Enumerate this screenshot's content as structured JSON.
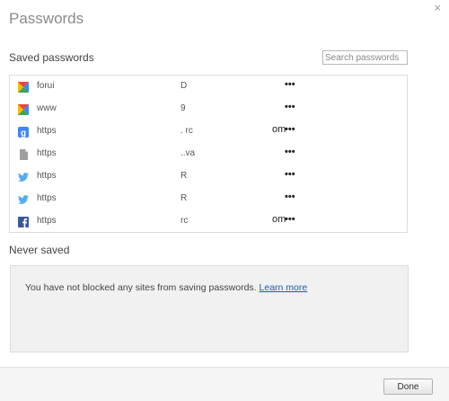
{
  "dialog": {
    "title": "Passwords",
    "close_glyph": "×"
  },
  "saved": {
    "label": "Saved passwords",
    "search_placeholder": "Search passwords",
    "entries": [
      {
        "icon": "google-colored-favicon-icon",
        "site": "forui",
        "user": "D",
        "password": "•••"
      },
      {
        "icon": "google-colored-favicon-icon",
        "site": "www",
        "user": "9",
        "password": "•••"
      },
      {
        "icon": "google-g-icon",
        "site": "https",
        "user": ". rc",
        "tail": "om",
        "password": "•••"
      },
      {
        "icon": "document-icon",
        "site": "https",
        "user": "..va",
        "password": "•••"
      },
      {
        "icon": "twitter-bird-icon",
        "site": "https",
        "user": "R",
        "password": "•••"
      },
      {
        "icon": "twitter-bird-icon",
        "site": "https",
        "user": "R",
        "password": "•••"
      },
      {
        "icon": "facebook-icon",
        "site": "https",
        "user": "rc",
        "tail": "om",
        "password": "•••"
      }
    ]
  },
  "never": {
    "label": "Never saved",
    "message": "You have not blocked any sites from saving passwords.",
    "link": "Learn more"
  },
  "footer": {
    "done_label": "Done"
  },
  "colors": {
    "link": "#1a5bb8",
    "twitter": "#55acee",
    "facebook": "#3b5998",
    "google": "#4285f4"
  }
}
